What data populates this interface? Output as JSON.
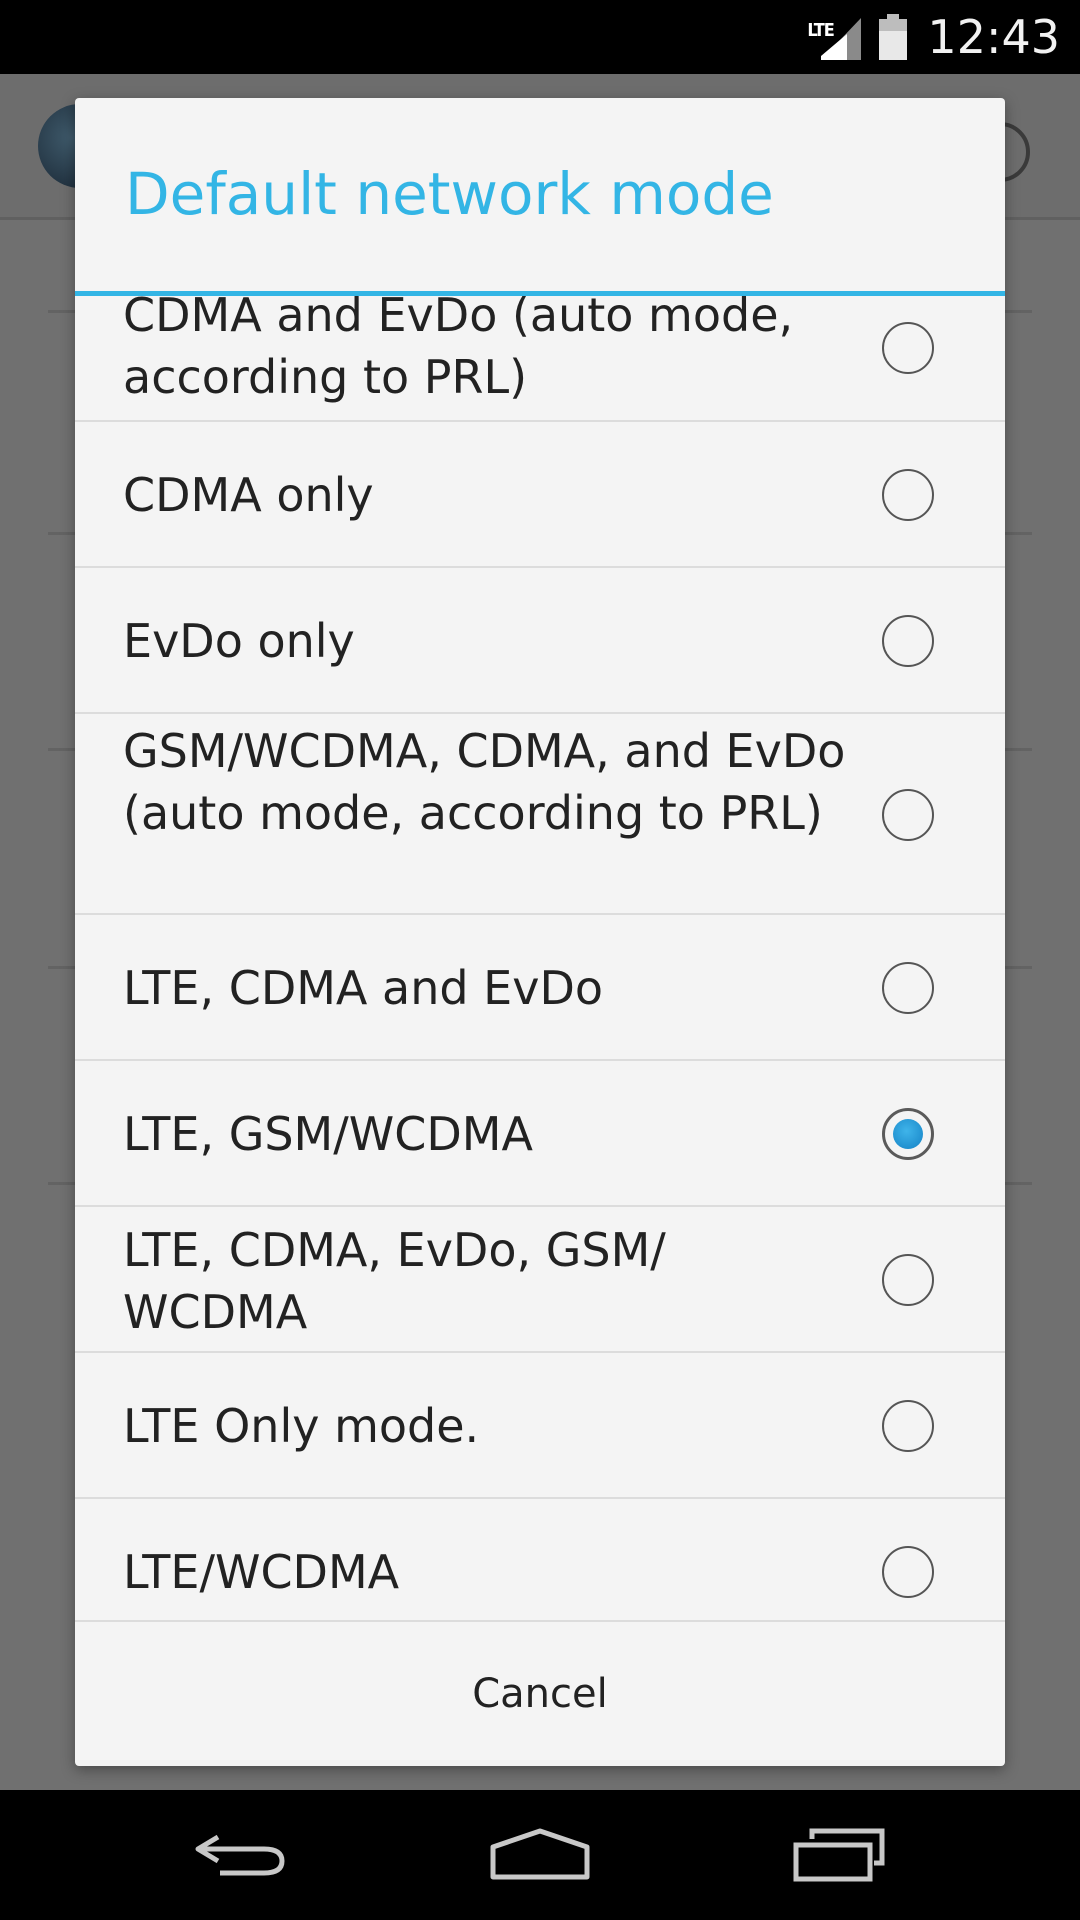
{
  "status_bar": {
    "network_type": "LTE",
    "time": "12:43"
  },
  "dialog": {
    "title": "Default network mode",
    "options": [
      {
        "label": "CDMA and EvDo (auto mode, according to PRL)",
        "selected": false
      },
      {
        "label": "CDMA only",
        "selected": false
      },
      {
        "label": "EvDo only",
        "selected": false
      },
      {
        "label": "GSM/WCDMA, CDMA, and EvDo (auto mode, according to PRL)",
        "selected": false
      },
      {
        "label": "LTE, CDMA and EvDo",
        "selected": false
      },
      {
        "label": "LTE, GSM/WCDMA",
        "selected": true
      },
      {
        "label": "LTE, CDMA, EvDo, GSM/ WCDMA",
        "selected": false
      },
      {
        "label": "LTE Only mode.",
        "selected": false
      },
      {
        "label": "LTE/WCDMA",
        "selected": false
      }
    ],
    "cancel_label": "Cancel"
  },
  "colors": {
    "accent": "#33b5e5",
    "dialog_background": "#f4f4f4",
    "scrim": "#707070",
    "selected_radio": "#1e9ad6"
  },
  "icons": {
    "status": [
      "signal-icon",
      "battery-icon"
    ],
    "navigation": [
      "back-icon",
      "home-icon",
      "recents-icon"
    ]
  }
}
